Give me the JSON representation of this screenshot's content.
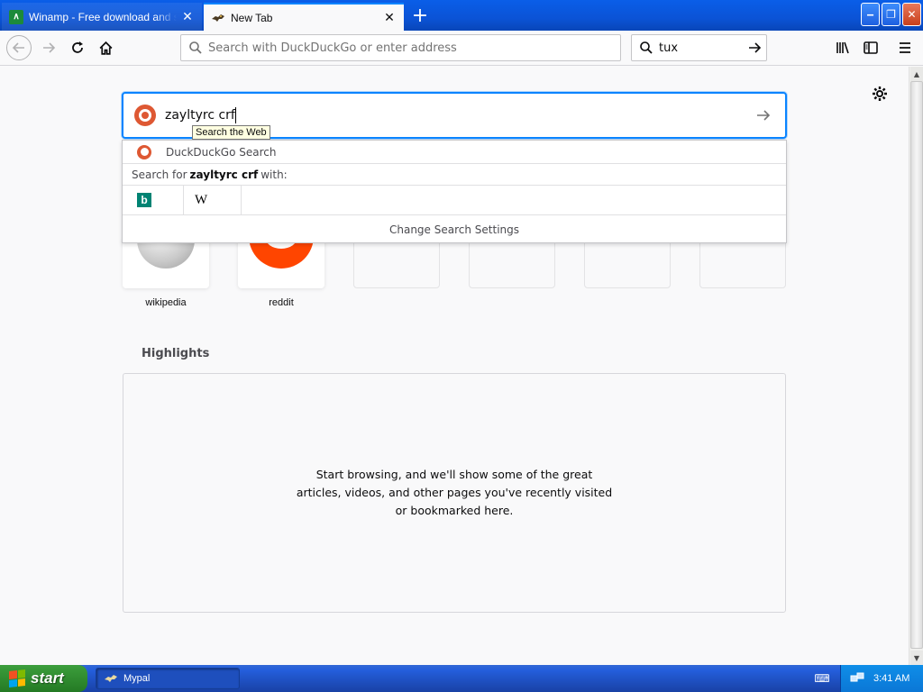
{
  "tabs": [
    {
      "label": "Winamp - Free download and software",
      "favicon": "winamp-icon"
    },
    {
      "label": "New Tab",
      "favicon": "mypal-icon"
    }
  ],
  "window_controls": {
    "minimize": "minimize-icon",
    "maximize": "maximize-icon",
    "close": "close-icon"
  },
  "toolbar": {
    "url_placeholder": "Search with DuckDuckGo or enter address",
    "search_value": "tux"
  },
  "newtab": {
    "search_query": "zayltyrc crf",
    "tooltip": "Search the Web",
    "suggestion": "DuckDuckGo Search",
    "search_for_prefix": "Search for",
    "search_for_term": "zayltyrc crf",
    "search_for_suffix": "with:",
    "engines": [
      {
        "name": "Bing",
        "icon": "bing-icon",
        "glyph": "b"
      },
      {
        "name": "Wikipedia",
        "icon": "wikipedia-icon",
        "glyph": "W"
      }
    ],
    "change_settings": "Change Search Settings",
    "top_sites": [
      {
        "label": "wikipedia"
      },
      {
        "label": "reddit"
      }
    ],
    "highlights_title": "Highlights",
    "highlights_message": "Start browsing, and we'll show some of the great articles, videos, and other pages you've recently visited or bookmarked here."
  },
  "taskbar": {
    "start_label": "start",
    "task_label": "Mypal",
    "clock": "3:41 AM"
  },
  "colors": {
    "accent": "#0a84ff",
    "ddg": "#de5833",
    "reddit": "#ff4500",
    "xp_blue": "#245edb",
    "start_green": "#308c30"
  }
}
